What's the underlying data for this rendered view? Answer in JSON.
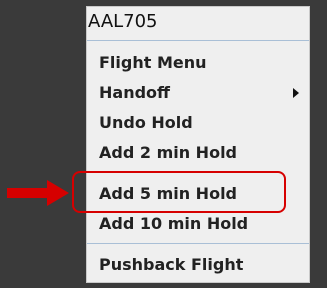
{
  "menu": {
    "title": "AAL705",
    "items": [
      {
        "label": "Flight Menu"
      },
      {
        "label": "Handoff",
        "has_submenu": true
      },
      {
        "label": "Undo Hold"
      },
      {
        "label": "Add 2 min Hold"
      },
      {
        "label": "Add 5 min Hold",
        "highlighted": true
      },
      {
        "label": "Add 10 min Hold"
      },
      {
        "label": "Pushback Flight"
      }
    ]
  },
  "annotation": {
    "color": "#d60000",
    "icon": "right-arrow-icon"
  }
}
